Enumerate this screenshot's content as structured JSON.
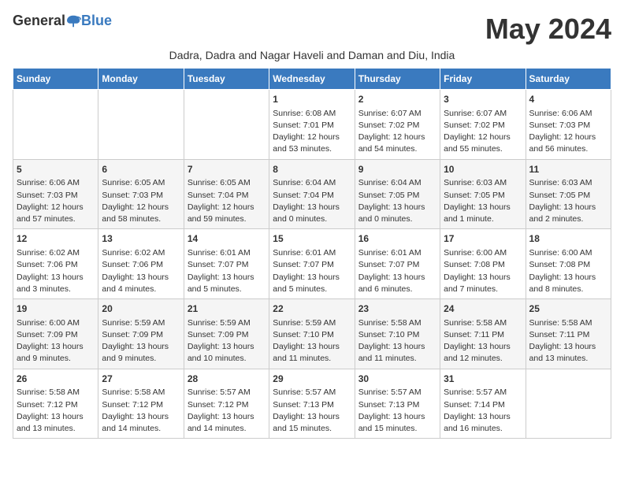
{
  "header": {
    "logo_general": "General",
    "logo_blue": "Blue",
    "month_title": "May 2024",
    "subtitle": "Dadra, Dadra and Nagar Haveli and Daman and Diu, India"
  },
  "weekdays": [
    "Sunday",
    "Monday",
    "Tuesday",
    "Wednesday",
    "Thursday",
    "Friday",
    "Saturday"
  ],
  "weeks": [
    [
      {
        "day": "",
        "info": ""
      },
      {
        "day": "",
        "info": ""
      },
      {
        "day": "",
        "info": ""
      },
      {
        "day": "1",
        "info": "Sunrise: 6:08 AM\nSunset: 7:01 PM\nDaylight: 12 hours\nand 53 minutes."
      },
      {
        "day": "2",
        "info": "Sunrise: 6:07 AM\nSunset: 7:02 PM\nDaylight: 12 hours\nand 54 minutes."
      },
      {
        "day": "3",
        "info": "Sunrise: 6:07 AM\nSunset: 7:02 PM\nDaylight: 12 hours\nand 55 minutes."
      },
      {
        "day": "4",
        "info": "Sunrise: 6:06 AM\nSunset: 7:03 PM\nDaylight: 12 hours\nand 56 minutes."
      }
    ],
    [
      {
        "day": "5",
        "info": "Sunrise: 6:06 AM\nSunset: 7:03 PM\nDaylight: 12 hours\nand 57 minutes."
      },
      {
        "day": "6",
        "info": "Sunrise: 6:05 AM\nSunset: 7:03 PM\nDaylight: 12 hours\nand 58 minutes."
      },
      {
        "day": "7",
        "info": "Sunrise: 6:05 AM\nSunset: 7:04 PM\nDaylight: 12 hours\nand 59 minutes."
      },
      {
        "day": "8",
        "info": "Sunrise: 6:04 AM\nSunset: 7:04 PM\nDaylight: 13 hours\nand 0 minutes."
      },
      {
        "day": "9",
        "info": "Sunrise: 6:04 AM\nSunset: 7:05 PM\nDaylight: 13 hours\nand 0 minutes."
      },
      {
        "day": "10",
        "info": "Sunrise: 6:03 AM\nSunset: 7:05 PM\nDaylight: 13 hours\nand 1 minute."
      },
      {
        "day": "11",
        "info": "Sunrise: 6:03 AM\nSunset: 7:05 PM\nDaylight: 13 hours\nand 2 minutes."
      }
    ],
    [
      {
        "day": "12",
        "info": "Sunrise: 6:02 AM\nSunset: 7:06 PM\nDaylight: 13 hours\nand 3 minutes."
      },
      {
        "day": "13",
        "info": "Sunrise: 6:02 AM\nSunset: 7:06 PM\nDaylight: 13 hours\nand 4 minutes."
      },
      {
        "day": "14",
        "info": "Sunrise: 6:01 AM\nSunset: 7:07 PM\nDaylight: 13 hours\nand 5 minutes."
      },
      {
        "day": "15",
        "info": "Sunrise: 6:01 AM\nSunset: 7:07 PM\nDaylight: 13 hours\nand 5 minutes."
      },
      {
        "day": "16",
        "info": "Sunrise: 6:01 AM\nSunset: 7:07 PM\nDaylight: 13 hours\nand 6 minutes."
      },
      {
        "day": "17",
        "info": "Sunrise: 6:00 AM\nSunset: 7:08 PM\nDaylight: 13 hours\nand 7 minutes."
      },
      {
        "day": "18",
        "info": "Sunrise: 6:00 AM\nSunset: 7:08 PM\nDaylight: 13 hours\nand 8 minutes."
      }
    ],
    [
      {
        "day": "19",
        "info": "Sunrise: 6:00 AM\nSunset: 7:09 PM\nDaylight: 13 hours\nand 9 minutes."
      },
      {
        "day": "20",
        "info": "Sunrise: 5:59 AM\nSunset: 7:09 PM\nDaylight: 13 hours\nand 9 minutes."
      },
      {
        "day": "21",
        "info": "Sunrise: 5:59 AM\nSunset: 7:09 PM\nDaylight: 13 hours\nand 10 minutes."
      },
      {
        "day": "22",
        "info": "Sunrise: 5:59 AM\nSunset: 7:10 PM\nDaylight: 13 hours\nand 11 minutes."
      },
      {
        "day": "23",
        "info": "Sunrise: 5:58 AM\nSunset: 7:10 PM\nDaylight: 13 hours\nand 11 minutes."
      },
      {
        "day": "24",
        "info": "Sunrise: 5:58 AM\nSunset: 7:11 PM\nDaylight: 13 hours\nand 12 minutes."
      },
      {
        "day": "25",
        "info": "Sunrise: 5:58 AM\nSunset: 7:11 PM\nDaylight: 13 hours\nand 13 minutes."
      }
    ],
    [
      {
        "day": "26",
        "info": "Sunrise: 5:58 AM\nSunset: 7:12 PM\nDaylight: 13 hours\nand 13 minutes."
      },
      {
        "day": "27",
        "info": "Sunrise: 5:58 AM\nSunset: 7:12 PM\nDaylight: 13 hours\nand 14 minutes."
      },
      {
        "day": "28",
        "info": "Sunrise: 5:57 AM\nSunset: 7:12 PM\nDaylight: 13 hours\nand 14 minutes."
      },
      {
        "day": "29",
        "info": "Sunrise: 5:57 AM\nSunset: 7:13 PM\nDaylight: 13 hours\nand 15 minutes."
      },
      {
        "day": "30",
        "info": "Sunrise: 5:57 AM\nSunset: 7:13 PM\nDaylight: 13 hours\nand 15 minutes."
      },
      {
        "day": "31",
        "info": "Sunrise: 5:57 AM\nSunset: 7:14 PM\nDaylight: 13 hours\nand 16 minutes."
      },
      {
        "day": "",
        "info": ""
      }
    ]
  ]
}
